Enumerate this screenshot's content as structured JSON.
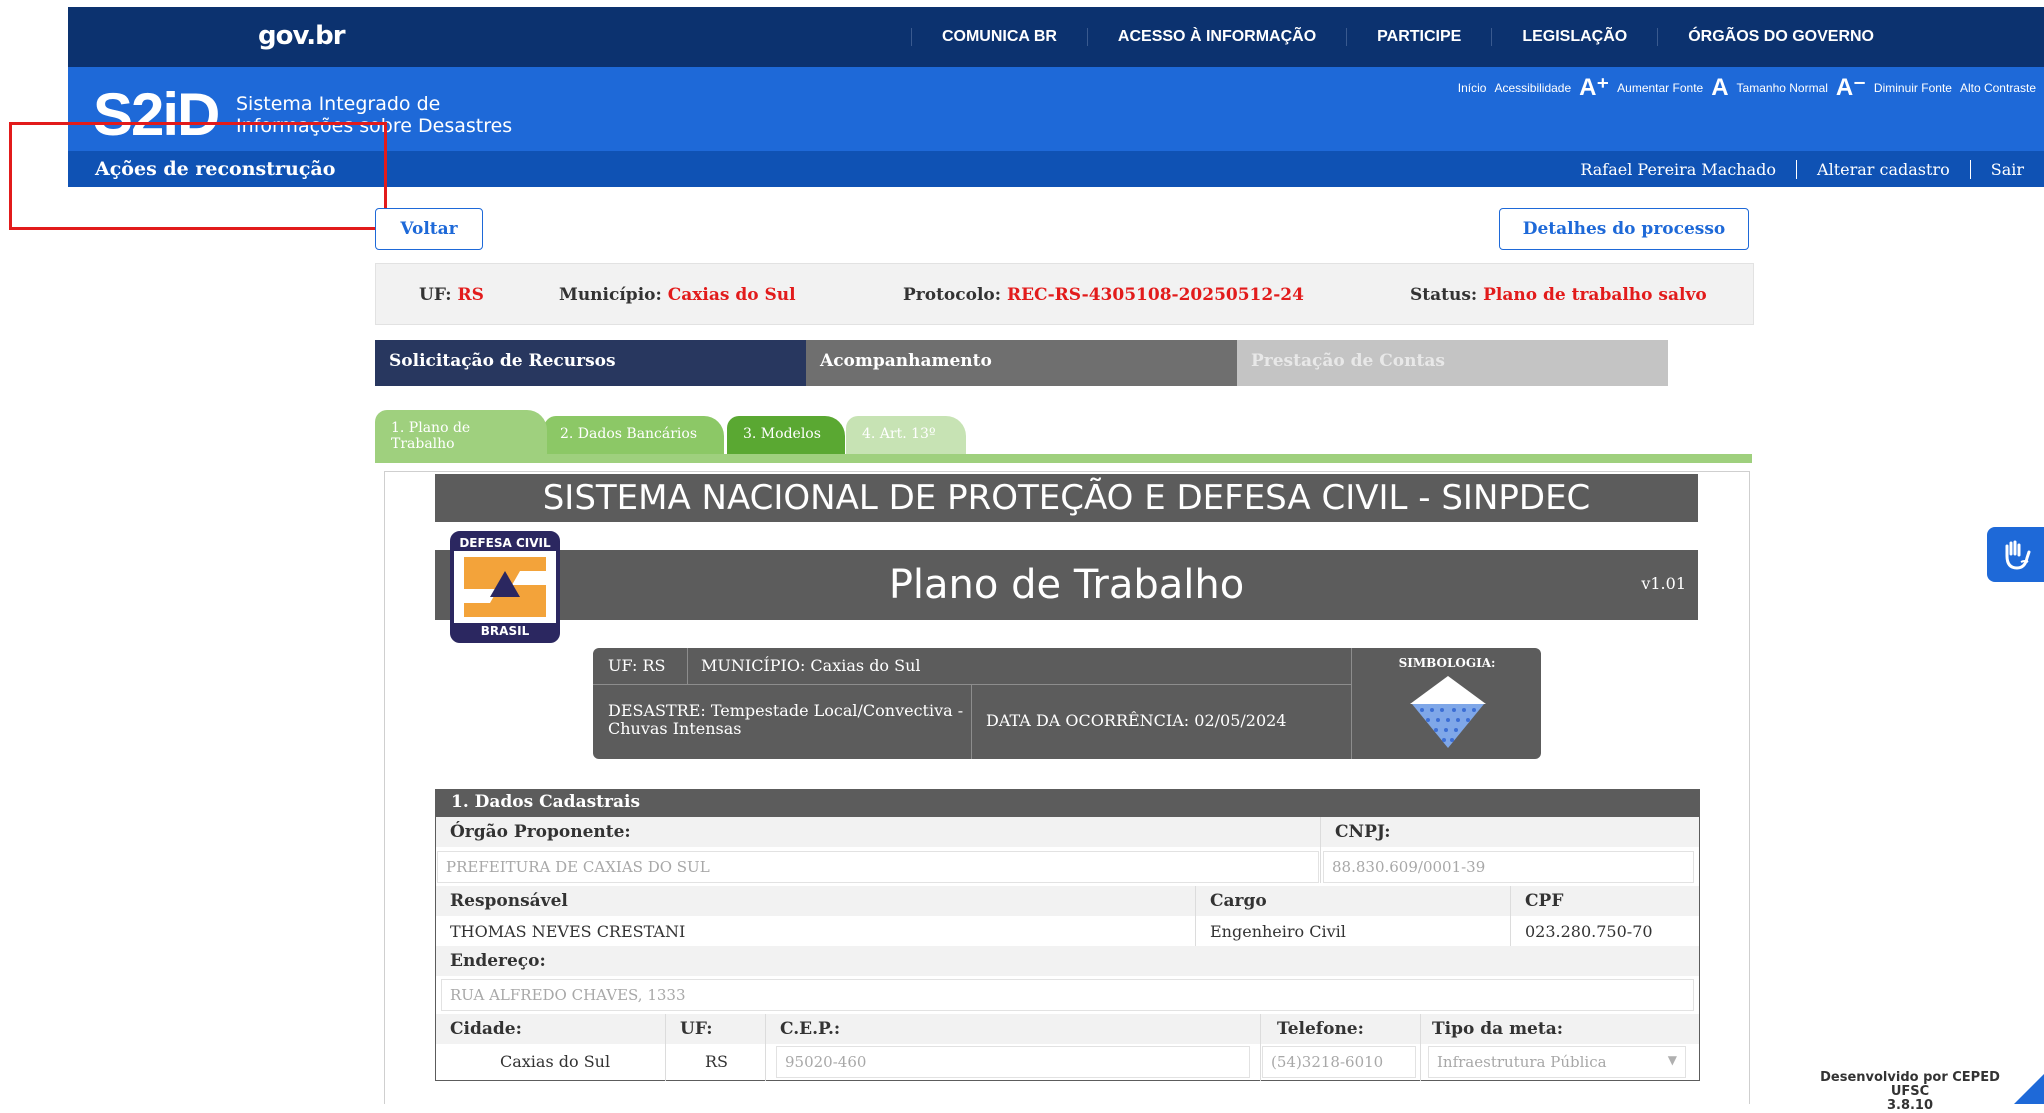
{
  "gov": {
    "logo": "gov.br",
    "links": [
      "COMUNICA BR",
      "ACESSO À INFORMAÇÃO",
      "PARTICIPE",
      "LEGISLAÇÃO",
      "ÓRGÃOS DO GOVERNO"
    ]
  },
  "s2id": {
    "logo": "S2iD",
    "subtitle_line1": "Sistema Integrado de",
    "subtitle_line2": "Informações sobre Desastres",
    "accessibility": {
      "inicio": "Início",
      "acessibilidade": "Acessibilidade",
      "aumentar_glyph": "A⁺",
      "aumentar": "Aumentar Fonte",
      "normal_glyph": "A",
      "normal": "Tamanho Normal",
      "diminuir_glyph": "A⁻",
      "diminuir": "Diminuir Fonte",
      "contraste": "Alto Contraste"
    }
  },
  "subnav": {
    "title": "Ações de reconstrução",
    "user": "Rafael Pereira Machado",
    "alterar": "Alterar cadastro",
    "sair": "Sair"
  },
  "actions": {
    "voltar": "Voltar",
    "detalhes": "Detalhes do processo"
  },
  "info": {
    "uf_label": "UF:",
    "uf": "RS",
    "municipio_label": "Município:",
    "municipio": "Caxias do Sul",
    "protocolo_label": "Protocolo:",
    "protocolo": "REC-RS-4305108-20250512-24",
    "status_label": "Status:",
    "status": "Plano de trabalho salvo"
  },
  "main_tabs": [
    "Solicitação de Recursos",
    "Acompanhamento",
    "Prestação de Contas"
  ],
  "sub_tabs": [
    "1. Plano de Trabalho",
    "2. Dados Bancários",
    "3. Modelos",
    "4. Art. 13º"
  ],
  "form": {
    "banner": "SISTEMA NACIONAL DE PROTEÇÃO E DEFESA CIVIL - SINPDEC",
    "title": "Plano de Trabalho",
    "version": "v1.01",
    "logo_top": "DEFESA CIVIL",
    "logo_bottom": "BRASIL",
    "box": {
      "uf": "UF: RS",
      "municipio": "MUNICÍPIO: Caxias do Sul",
      "desastre_l1": "DESASTRE: Tempestade Local/Convectiva -",
      "desastre_l2": "Chuvas Intensas",
      "data": "DATA DA OCORRÊNCIA: 02/05/2024",
      "simbologia": "SIMBOLOGIA:"
    },
    "section": {
      "title": "1. Dados Cadastrais",
      "orgao_label": "Órgão Proponente:",
      "orgao": "PREFEITURA DE CAXIAS DO SUL",
      "cnpj_label": "CNPJ:",
      "cnpj": "88.830.609/0001-39",
      "responsavel_label": "Responsável",
      "responsavel": "THOMAS NEVES CRESTANI",
      "cargo_label": "Cargo",
      "cargo": "Engenheiro Civil",
      "cpf_label": "CPF",
      "cpf": "023.280.750-70",
      "endereco_label": "Endereço:",
      "endereco": "RUA ALFREDO CHAVES, 1333",
      "cidade_label": "Cidade:",
      "cidade": "Caxias do Sul",
      "uf_label": "UF:",
      "uf": "RS",
      "cep_label": "C.E.P.:",
      "cep": "95020-460",
      "telefone_label": "Telefone:",
      "telefone": "(54)3218-6010",
      "tipo_label": "Tipo da meta:",
      "tipo": "Infraestrutura Pública"
    }
  },
  "footer": {
    "line1": "Desenvolvido por CEPED UFSC",
    "line2": "3.8.10"
  },
  "colors": {
    "gov_blue": "#0c326f",
    "s2id_blue": "#1e69d8",
    "subnav_blue": "#0f52b4",
    "tab_dark": "#28375f",
    "tab_mid": "#6f6f6f",
    "tab_light": "#c4c4c4",
    "subtab_green": "#5aa832",
    "red": "#e21b1b"
  }
}
